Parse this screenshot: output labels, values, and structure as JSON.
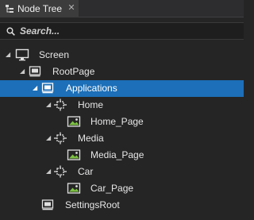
{
  "panel": {
    "tab_label": "Node Tree",
    "tab_close": "✕"
  },
  "search": {
    "placeholder": "Search..."
  },
  "tree": {
    "screen": "Screen",
    "rootpage": "RootPage",
    "applications": "Applications",
    "home": "Home",
    "home_page": "Home_Page",
    "media": "Media",
    "media_page": "Media_Page",
    "car": "Car",
    "car_page": "Car_Page",
    "settingsroot": "SettingsRoot"
  },
  "colors": {
    "selection": "#1c6fb8",
    "background": "#252526"
  }
}
